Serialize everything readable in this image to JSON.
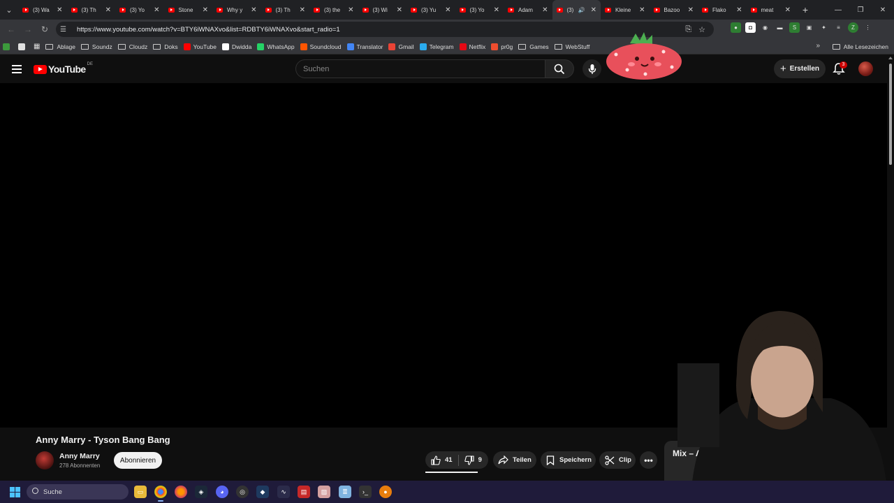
{
  "tabs": [
    {
      "title": "(3) Wa",
      "active": false
    },
    {
      "title": "(3) Th",
      "active": false
    },
    {
      "title": "(3) Yo",
      "active": false
    },
    {
      "title": "Stone",
      "active": false
    },
    {
      "title": "Why y",
      "active": false
    },
    {
      "title": "(3) Th",
      "active": false
    },
    {
      "title": "(3) the",
      "active": false
    },
    {
      "title": "(3) Wi",
      "active": false
    },
    {
      "title": "(3) Yu",
      "active": false
    },
    {
      "title": "(3) Yo",
      "active": false
    },
    {
      "title": "Adam",
      "active": false
    },
    {
      "title": "(3)",
      "active": true
    },
    {
      "title": "Kleine",
      "active": false
    },
    {
      "title": "Bazoo",
      "active": false
    },
    {
      "title": "Flako",
      "active": false
    },
    {
      "title": "meat",
      "active": false
    }
  ],
  "address": {
    "url": "https://www.youtube.com/watch?v=BTY6iWNAXvo&list=RDBTY6iWNAXvo&start_radio=1"
  },
  "bookmarks": [
    {
      "label": "Ablage",
      "kind": "folder"
    },
    {
      "label": "Soundz",
      "kind": "folder"
    },
    {
      "label": "Cloudz",
      "kind": "folder"
    },
    {
      "label": "Doks",
      "kind": "folder"
    },
    {
      "label": "YouTube",
      "kind": "site",
      "color": "#ff0000"
    },
    {
      "label": "Dwidda",
      "kind": "site",
      "color": "#ffffff"
    },
    {
      "label": "WhatsApp",
      "kind": "site",
      "color": "#25d366"
    },
    {
      "label": "Soundcloud",
      "kind": "site",
      "color": "#ff5500"
    },
    {
      "label": "Translator",
      "kind": "site",
      "color": "#4285f4"
    },
    {
      "label": "Gmail",
      "kind": "site",
      "color": "#ea4335"
    },
    {
      "label": "Telegram",
      "kind": "site",
      "color": "#2aabee"
    },
    {
      "label": "Netflix",
      "kind": "site",
      "color": "#e50914"
    },
    {
      "label": "pr0g",
      "kind": "site",
      "color": "#ee4d2e"
    },
    {
      "label": "Games",
      "kind": "folder"
    },
    {
      "label": "WebStuff",
      "kind": "folder"
    }
  ],
  "bookmarks_all": "Alle Lesezeichen",
  "yt": {
    "logo_text": "YouTube",
    "country": "DE",
    "search_placeholder": "Suchen",
    "create_label": "Erstellen",
    "notif_count": "3"
  },
  "video": {
    "title": "Anny Marry - Tyson Bang Bang",
    "channel": "Anny Marry",
    "subscribers": "278 Abonnenten",
    "subscribe_label": "Abonnieren",
    "likes": "41",
    "dislikes": "9",
    "share_label": "Teilen",
    "save_label": "Speichern",
    "clip_label": "Clip",
    "mix_label": "Mix – Anr"
  },
  "taskbar": {
    "search_label": "Suche"
  },
  "colors": {
    "brand": "#ff0000",
    "bg": "#0f0f0f",
    "pill": "#272727",
    "taskbar": "#1f1b3a"
  }
}
